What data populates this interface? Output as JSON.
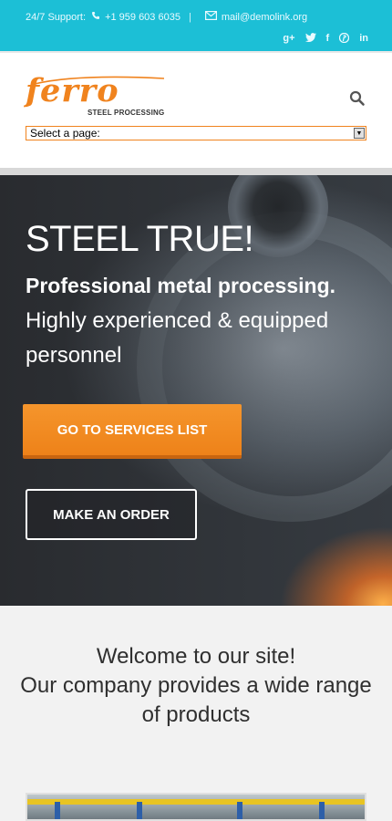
{
  "topbar": {
    "support_label": "24/7 Support:",
    "phone": "+1 959 603 6035",
    "separator": "|",
    "email": "mail@demolink.org",
    "social": [
      {
        "icon": "google-plus-icon",
        "glyph": "g+"
      },
      {
        "icon": "twitter-icon",
        "glyph": "t"
      },
      {
        "icon": "facebook-icon",
        "glyph": "f"
      },
      {
        "icon": "pinterest-icon",
        "glyph": "p"
      },
      {
        "icon": "linkedin-icon",
        "glyph": "in"
      }
    ],
    "bg_color": "#1cbfd6"
  },
  "header": {
    "logo_text": "ferro",
    "logo_tagline": "STEEL PROCESSING",
    "page_select": "Select a page:",
    "accent_color": "#f0831e"
  },
  "hero": {
    "title": "STEEL TRUE!",
    "lead": "Professional metal processing.",
    "sub": "Highly experienced & equipped personnel",
    "primary_button": "GO TO SERVICES LIST",
    "secondary_button": "MAKE AN ORDER"
  },
  "welcome": {
    "line1": "Welcome to our site!",
    "line2": "Our company provides a wide range of products"
  }
}
